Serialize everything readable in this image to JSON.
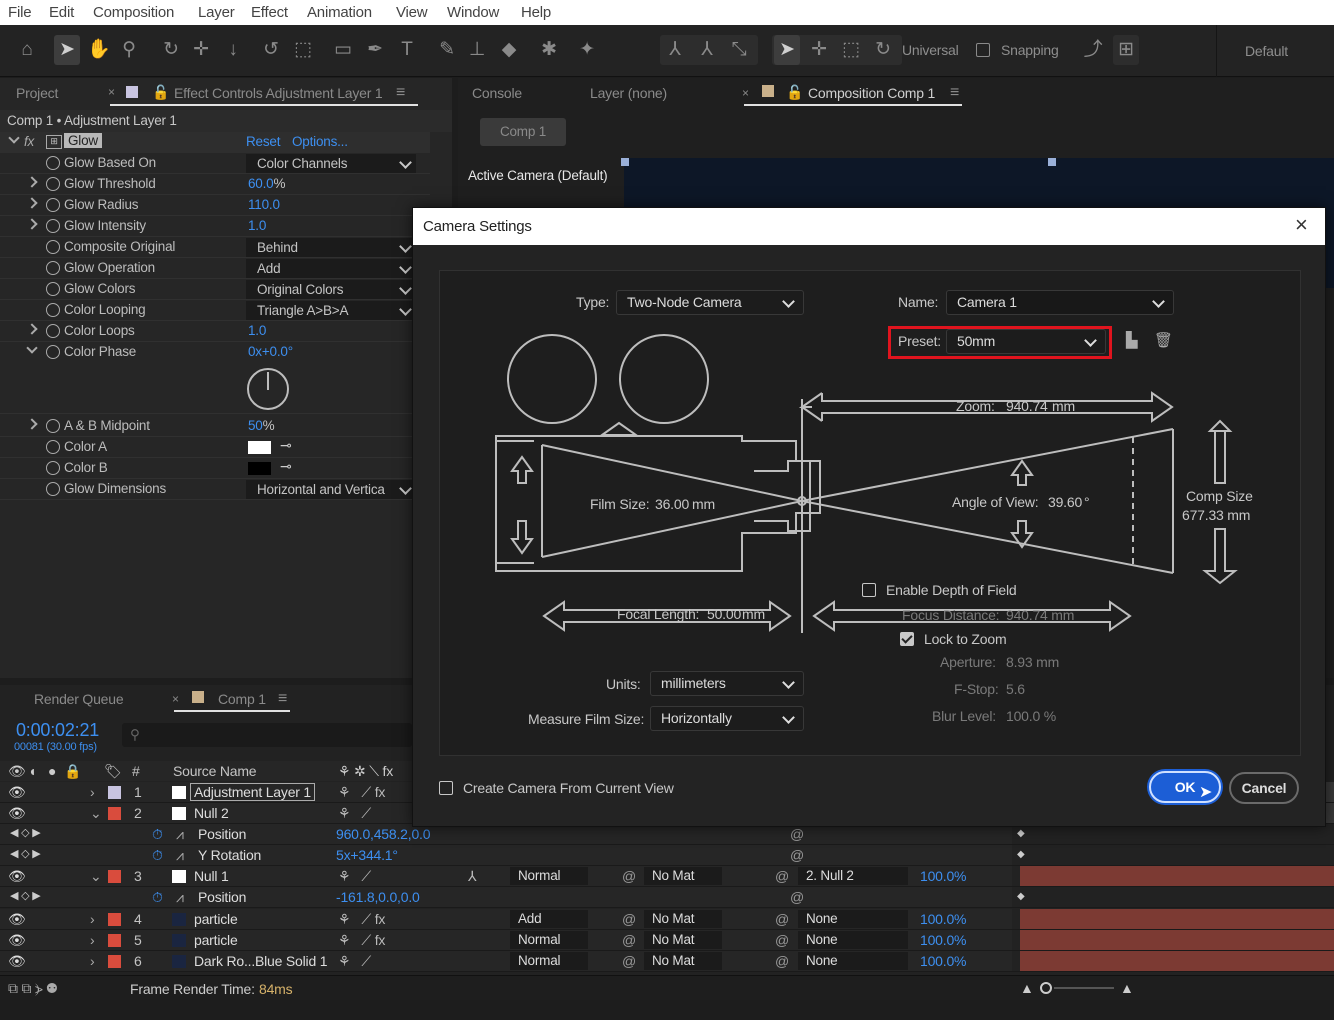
{
  "menu": [
    "File",
    "Edit",
    "Composition",
    "Layer",
    "Effect",
    "Animation",
    "View",
    "Window",
    "Help"
  ],
  "toolbar": {
    "axis_mode": "Universal",
    "snapping": "Snapping",
    "workspace": "Default"
  },
  "left_panel": {
    "tab_project": "Project",
    "tab_effect_controls": "Effect Controls Adjustment Layer 1",
    "breadcrumb": "Comp 1 • Adjustment Layer 1",
    "effect_name": "Glow",
    "reset": "Reset",
    "options": "Options...",
    "props": [
      {
        "label": "Glow Based On",
        "dropdown": "Color Channels"
      },
      {
        "label": "Glow Threshold",
        "value": "60.0",
        "unit": "%"
      },
      {
        "label": "Glow Radius",
        "value": "110.0"
      },
      {
        "label": "Glow Intensity",
        "value": "1.0"
      },
      {
        "label": "Composite Original",
        "dropdown": "Behind"
      },
      {
        "label": "Glow Operation",
        "dropdown": "Add"
      },
      {
        "label": "Glow Colors",
        "dropdown": "Original Colors"
      },
      {
        "label": "Color Looping",
        "dropdown": "Triangle A>B>A"
      },
      {
        "label": "Color Loops",
        "value": "1.0"
      },
      {
        "label": "Color Phase",
        "value": "0x+0.0°"
      },
      {
        "label": "A & B Midpoint",
        "value": "50",
        "unit": "%"
      },
      {
        "label": "Color A"
      },
      {
        "label": "Color B"
      },
      {
        "label": "Glow Dimensions",
        "dropdown": "Horizontal and Vertica"
      }
    ]
  },
  "right_panel": {
    "tab_console": "Console",
    "tab_layer": "Layer (none)",
    "tab_composition": "Composition Comp 1",
    "comp_button": "Comp 1",
    "active_camera": "Active Camera (Default)"
  },
  "timeline": {
    "tab_render_queue": "Render Queue",
    "tab_comp": "Comp 1",
    "timecode": "0:00:02:21",
    "frame_info": "00081 (30.00 fps)",
    "col_hash": "#",
    "col_source": "Source Name",
    "layers": [
      {
        "num": "1",
        "name": "Adjustment Layer 1"
      },
      {
        "num": "2",
        "name": "Null 2"
      },
      {
        "prop": "Position",
        "value": "960.0,458.2,0.0"
      },
      {
        "prop": "Y Rotation",
        "value": "5x+344.1°"
      },
      {
        "num": "3",
        "name": "Null 1",
        "mode": "Normal",
        "trk": "No Mat",
        "parent": "2. Null 2",
        "stretch": "100.0%"
      },
      {
        "prop": "Position",
        "value": "-161.8,0.0,0.0"
      },
      {
        "num": "4",
        "name": "particle",
        "mode": "Add",
        "trk": "No Mat",
        "parent": "None",
        "stretch": "100.0%"
      },
      {
        "num": "5",
        "name": "particle",
        "mode": "Normal",
        "trk": "No Mat",
        "parent": "None",
        "stretch": "100.0%"
      },
      {
        "num": "6",
        "name": "Dark Ro...Blue Solid 1",
        "mode": "Normal",
        "trk": "No Mat",
        "parent": "None",
        "stretch": "100.0%"
      }
    ],
    "frame_render_label": "Frame Render Time:",
    "frame_render_value": "84ms"
  },
  "dialog": {
    "title": "Camera Settings",
    "type_label": "Type:",
    "type_value": "Two-Node Camera",
    "name_label": "Name:",
    "name_value": "Camera 1",
    "preset_label": "Preset:",
    "preset_value": "50mm",
    "zoom_label": "Zoom:",
    "zoom_value": "940.74",
    "zoom_unit": "mm",
    "film_label": "Film Size:",
    "film_value": "36.00",
    "film_unit": "mm",
    "aov_label": "Angle of View:",
    "aov_value": "39.60",
    "aov_unit": "°",
    "comp_size_label": "Comp Size",
    "comp_size_value": "677.33 mm",
    "focal_label": "Focal Length:",
    "focal_value": "50.00",
    "focal_unit": "mm",
    "dof_label": "Enable Depth of Field",
    "focus_dist_label": "Focus Distance:",
    "focus_dist_value": "940.74 mm",
    "lock_zoom_label": "Lock to Zoom",
    "aperture_label": "Aperture:",
    "aperture_value": "8.93 mm",
    "fstop_label": "F-Stop:",
    "fstop_value": "5.6",
    "blur_label": "Blur Level:",
    "blur_value": "100.0 %",
    "units_label": "Units:",
    "units_value": "millimeters",
    "measure_label": "Measure Film Size:",
    "measure_value": "Horizontally",
    "create_from_view": "Create Camera From Current View",
    "ok": "OK",
    "cancel": "Cancel",
    "highlight_color": "#e0141e",
    "ok_color": "#1c5ed6"
  }
}
